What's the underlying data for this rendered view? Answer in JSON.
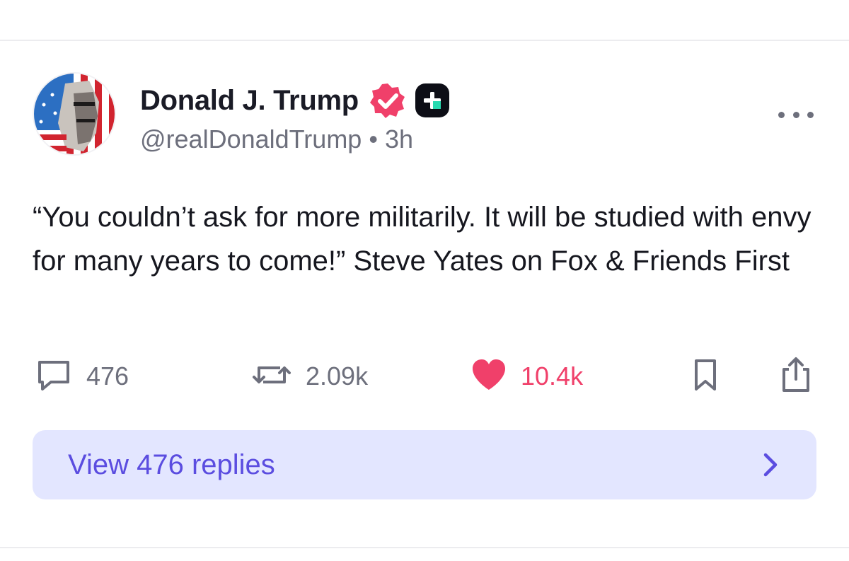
{
  "post": {
    "author": {
      "display_name": "Donald J. Trump",
      "handle": "@realDonaldTrump",
      "separator": "•",
      "time_ago": "3h"
    },
    "text": "“You couldn’t ask for more militarily. It will be studied with envy for many years to come!” Steve Yates on Fox & Friends First",
    "actions": {
      "replies_count": "476",
      "reposts_count": "2.09k",
      "likes_count": "10.4k"
    },
    "view_replies_label": "View 476 replies"
  },
  "icons": {
    "verified": "verified-badge-icon",
    "plus": "plus-badge-icon",
    "more": "more-horizontal-icon",
    "reply": "comment-bubble-icon",
    "repost": "repost-arrows-icon",
    "like": "heart-icon",
    "bookmark": "bookmark-icon",
    "share": "share-icon",
    "chevron": "chevron-right-icon"
  },
  "colors": {
    "accent_pink": "#f0406a",
    "accent_purple": "#5b4de0",
    "replies_bar_bg": "#e3e6ff",
    "muted_text": "#6d6f7c",
    "primary_text": "#16171f"
  }
}
